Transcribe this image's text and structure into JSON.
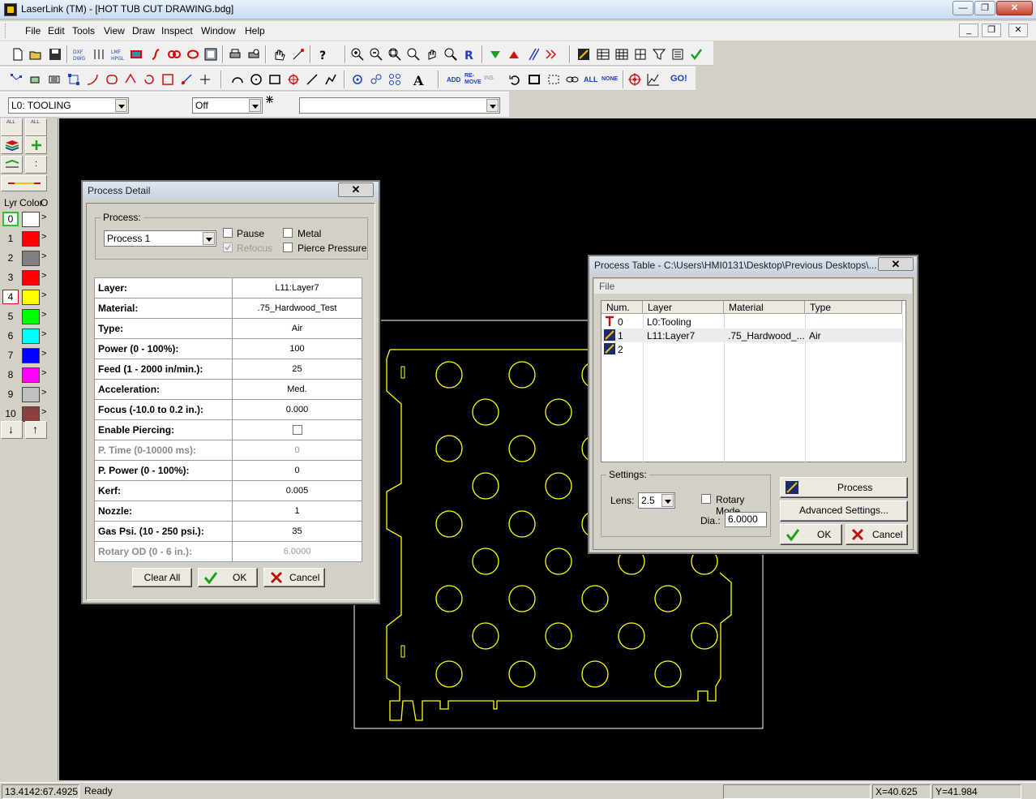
{
  "window": {
    "title": "LaserLink (TM) - [HOT TUB CUT DRAWING.bdg]"
  },
  "menu": [
    "File",
    "Edit",
    "Tools",
    "View",
    "Draw",
    "Inspect",
    "Window",
    "Help"
  ],
  "toolbar": {
    "layer_combo": "L0: TOOLING",
    "mode_combo": "Off",
    "text_combo": "",
    "add_label": "ADD",
    "remove_label": "RE-MOVE",
    "ins_label": "INS.",
    "all_label": "ALL",
    "none_label": "NONE",
    "go_label": "GO!"
  },
  "layer_panel": {
    "header_lyr": "Lyr",
    "header_color": "Color",
    "header_o": "O",
    "layers": [
      {
        "num": "0",
        "color": "#ffffff"
      },
      {
        "num": "1",
        "color": "#ff0000"
      },
      {
        "num": "2",
        "color": "#808080"
      },
      {
        "num": "3",
        "color": "#ff0000"
      },
      {
        "num": "4",
        "color": "#ffff00"
      },
      {
        "num": "5",
        "color": "#00ff00"
      },
      {
        "num": "6",
        "color": "#00ffff"
      },
      {
        "num": "7",
        "color": "#0000ff"
      },
      {
        "num": "8",
        "color": "#ff00ff"
      },
      {
        "num": "9",
        "color": "#c0c0c0"
      },
      {
        "num": "10",
        "color": "#8b4040"
      }
    ]
  },
  "status": {
    "coords": "13.4142:67.4925",
    "state": "Ready",
    "x": "X=40.625",
    "y": "Y=41.984"
  },
  "process_detail": {
    "title": "Process Detail",
    "process_label": "Process:",
    "process_value": "Process 1",
    "pause": "Pause",
    "refocus": "Refocus",
    "metal": "Metal",
    "pierce_pressure": "Pierce Pressure",
    "rows": [
      {
        "label": "Layer:",
        "value": "L11:Layer7"
      },
      {
        "label": "Material:",
        "value": ".75_Hardwood_Test"
      },
      {
        "label": "Type:",
        "value": "Air"
      },
      {
        "label": "Power (0 - 100%):",
        "value": "100"
      },
      {
        "label": "Feed (1 - 2000 in/min.):",
        "value": "25"
      },
      {
        "label": "Acceleration:",
        "value": "Med."
      },
      {
        "label": "Focus (-10.0 to 0.2 in.):",
        "value": "0.000"
      },
      {
        "label": "Enable Piercing:",
        "value": ""
      },
      {
        "label": "P. Time (0-10000 ms):",
        "value": "0"
      },
      {
        "label": "P. Power (0 - 100%):",
        "value": "0"
      },
      {
        "label": "Kerf:",
        "value": "0.005"
      },
      {
        "label": "Nozzle:",
        "value": "1"
      },
      {
        "label": "Gas Psi. (10 - 250 psi.):",
        "value": "35"
      },
      {
        "label": "Rotary OD (0 - 6 in.):",
        "value": "6.0000"
      }
    ],
    "clear_all": "Clear All",
    "ok": "OK",
    "cancel": "Cancel"
  },
  "process_table": {
    "title": "Process Table - C:\\Users\\HMI0131\\Desktop\\Previous Desktops\\...",
    "file_menu": "File",
    "columns": [
      "Num.",
      "Layer",
      "Material",
      "Type"
    ],
    "rows": [
      {
        "num": "0",
        "layer": "L0:Tooling",
        "material": "",
        "type": ""
      },
      {
        "num": "1",
        "layer": "L11:Layer7",
        "material": ".75_Hardwood_...",
        "type": "Air"
      },
      {
        "num": "2",
        "layer": "",
        "material": "",
        "type": ""
      }
    ],
    "settings_label": "Settings:",
    "lens_label": "Lens:",
    "lens_value": "2.5",
    "rotary_mode": "Rotary Mode",
    "dia_label": "Dia.:",
    "dia_value": "6.0000",
    "process_btn": "Process",
    "advanced_btn": "Advanced Settings...",
    "ok": "OK",
    "cancel": "Cancel"
  }
}
